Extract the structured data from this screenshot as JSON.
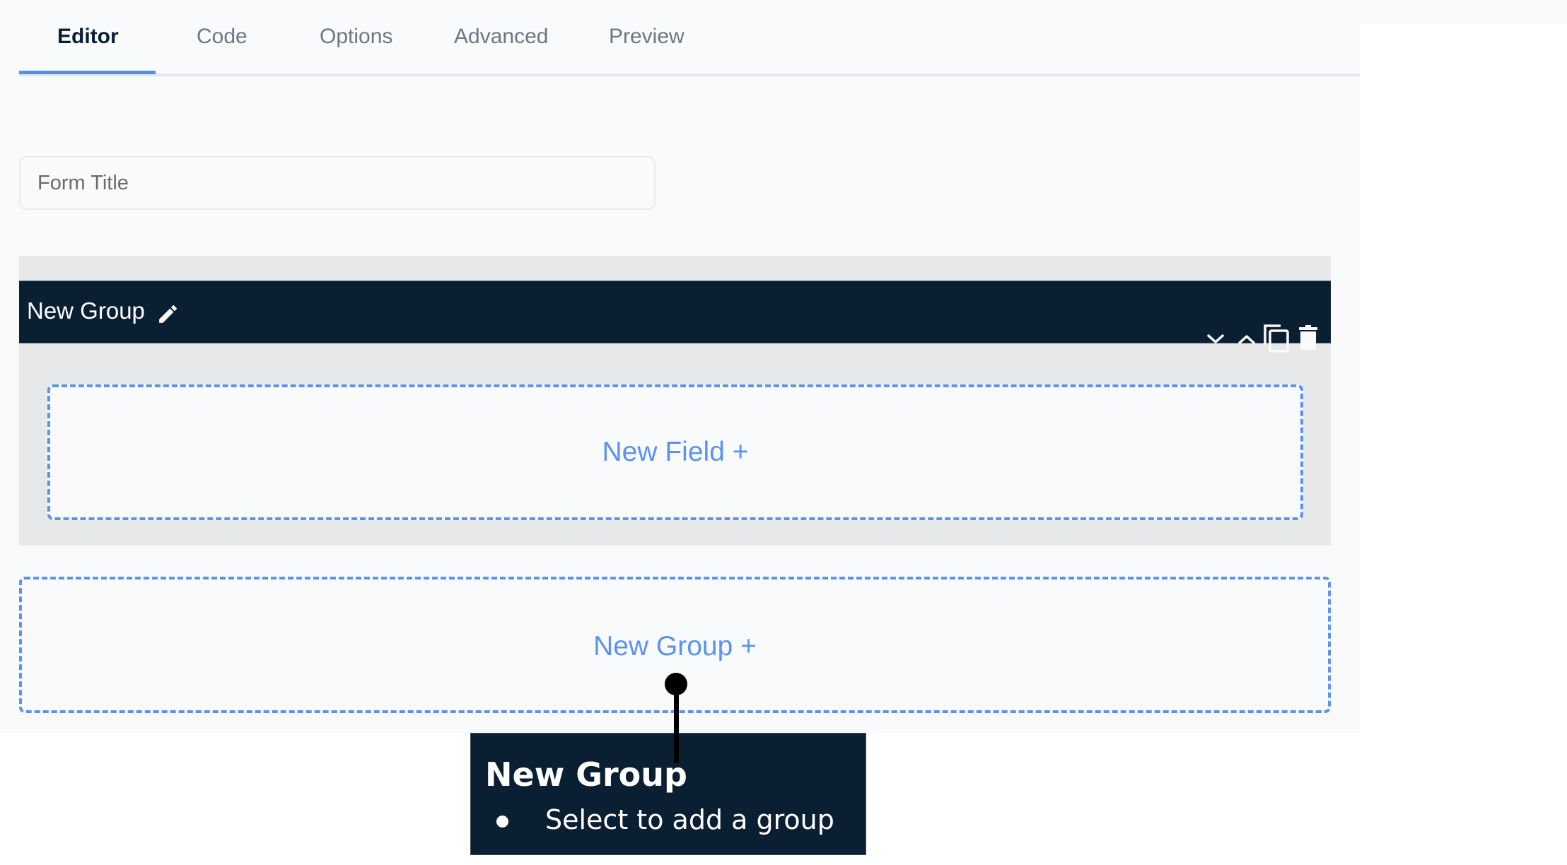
{
  "tabs": [
    {
      "label": "Editor",
      "active": true
    },
    {
      "label": "Code",
      "active": false
    },
    {
      "label": "Options",
      "active": false
    },
    {
      "label": "Advanced",
      "active": false
    },
    {
      "label": "Preview",
      "active": false
    }
  ],
  "form_title": {
    "value": "",
    "placeholder": "Form Title"
  },
  "group": {
    "title": "New Group",
    "icons": {
      "edit": "pencil-icon",
      "move_down": "chevron-down-icon",
      "move_up": "chevron-up-icon",
      "duplicate": "copy-icon",
      "delete": "trash-icon"
    },
    "new_field_label": "New Field +"
  },
  "new_group_label": "New Group +",
  "tooltip": {
    "title": "New Group",
    "bullets": [
      "Select to add a group"
    ]
  },
  "colors": {
    "accent": "#4f8fef",
    "drop_zone": "#5b93ee",
    "header_bg": "#0b1f33",
    "group_bg": "#e7e8ea",
    "panel_bg": "#f9fafc"
  }
}
